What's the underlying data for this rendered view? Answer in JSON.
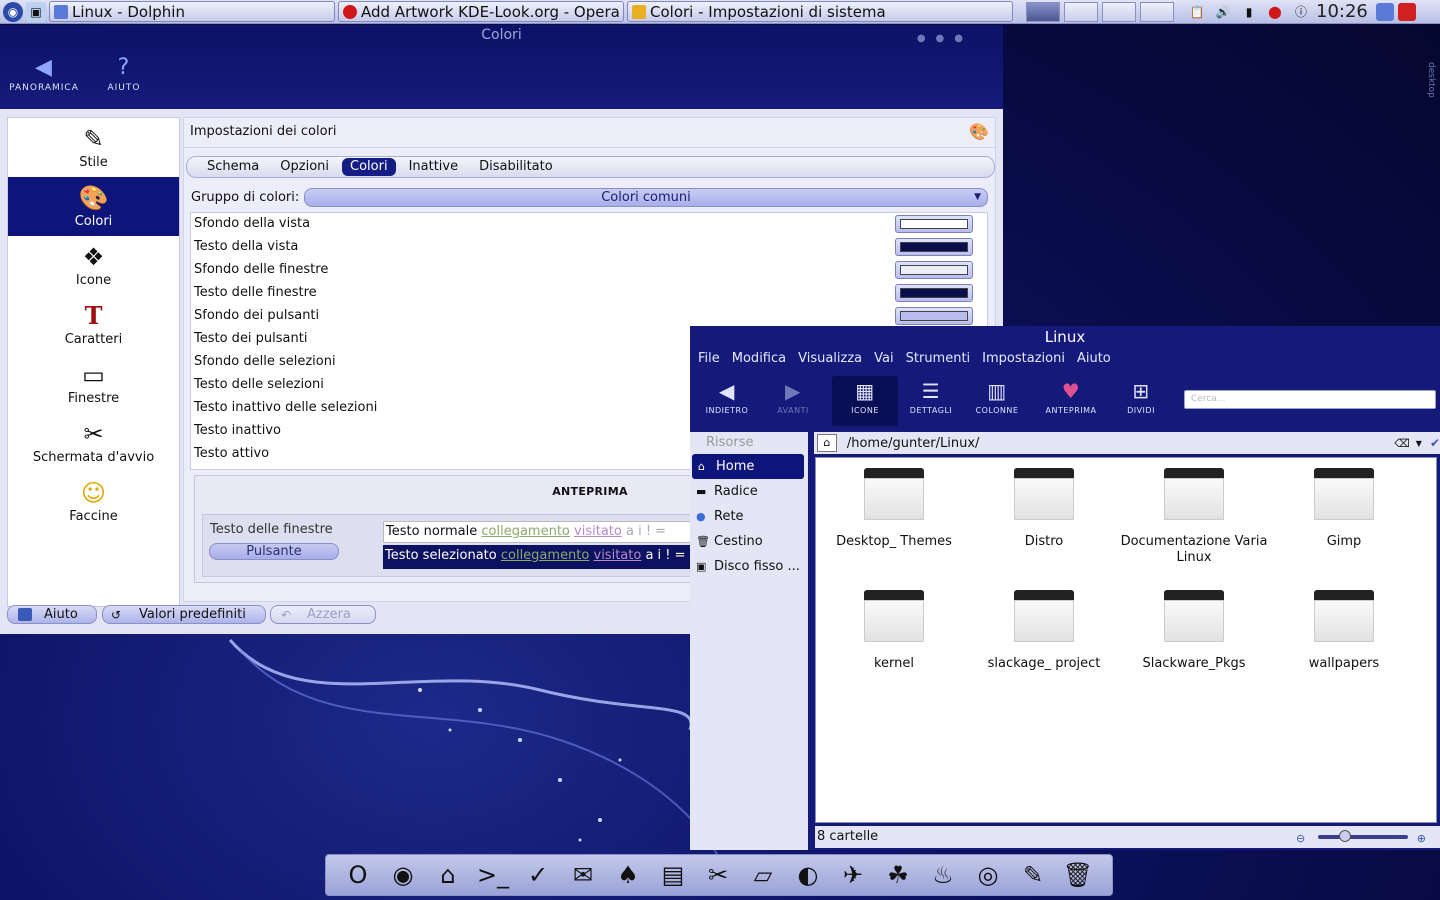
{
  "taskbar": {
    "tasks": [
      {
        "label": "Linux - Dolphin",
        "width": 286
      },
      {
        "label": "Add Artwork KDE-Look.org - Opera",
        "width": 286
      },
      {
        "label": "Colori - Impostazioni di sistema",
        "width": 386
      }
    ],
    "clock": "10:26"
  },
  "sysset": {
    "title": "Colori",
    "toolbar": {
      "overview": "PANORAMICA",
      "help": "AIUTO"
    },
    "sidebar": [
      {
        "label": "Stile",
        "icon": "✎"
      },
      {
        "label": "Colori",
        "icon": "🎨"
      },
      {
        "label": "Icone",
        "icon": "❖"
      },
      {
        "label": "Caratteri",
        "icon": "T"
      },
      {
        "label": "Finestre",
        "icon": "▭"
      },
      {
        "label": "Schermata d'avvio",
        "icon": "✂"
      },
      {
        "label": "Faccine",
        "icon": "☺"
      }
    ],
    "panel_title": "Impostazioni dei colori",
    "tabs": [
      "Schema",
      "Opzioni",
      "Colori",
      "Inattive",
      "Disabilitato"
    ],
    "group_label": "Gruppo di colori:",
    "group_value": "Colori comuni",
    "colors": [
      {
        "label": "Sfondo della vista",
        "color": "#ffffff"
      },
      {
        "label": "Testo della vista",
        "color": "#0a0e4a"
      },
      {
        "label": "Sfondo delle finestre",
        "color": "#eceef8"
      },
      {
        "label": "Testo delle finestre",
        "color": "#0a0e4a"
      },
      {
        "label": "Sfondo dei pulsanti",
        "color": "#b9bdee"
      },
      {
        "label": "Testo dei pulsanti",
        "color": ""
      },
      {
        "label": "Sfondo delle selezioni",
        "color": ""
      },
      {
        "label": "Testo delle selezioni",
        "color": ""
      },
      {
        "label": "Testo inattivo delle selezioni",
        "color": ""
      },
      {
        "label": "Testo inattivo",
        "color": ""
      },
      {
        "label": "Testo attivo",
        "color": ""
      }
    ],
    "preview": {
      "title": "ANTEPRIMA",
      "window_text": "Testo delle finestre",
      "button": "Pulsante",
      "normal_text": "Testo normale",
      "selected_text": "Testo selezionato",
      "link": "collegamento",
      "visited": "visitato",
      "tail": "a i  !  ="
    },
    "buttons": {
      "help": "Aiuto",
      "defaults": "Valori predefiniti",
      "reset": "Azzera"
    }
  },
  "dolphin": {
    "title": "Linux",
    "menu": [
      "File",
      "Modifica",
      "Visualizza",
      "Vai",
      "Strumenti",
      "Impostazioni",
      "Aiuto"
    ],
    "tools": [
      {
        "label": "INDIETRO",
        "icon": "◀"
      },
      {
        "label": "AVANTI",
        "icon": "▶"
      },
      {
        "label": "ICONE",
        "icon": "▦"
      },
      {
        "label": "DETTAGLI",
        "icon": "☰"
      },
      {
        "label": "COLONNE",
        "icon": "▥"
      },
      {
        "label": "ANTEPRIMA",
        "icon": "♥"
      },
      {
        "label": "DIVIDI",
        "icon": "⊞"
      }
    ],
    "search_placeholder": "Cerca...",
    "places_header": "Risorse",
    "places": [
      {
        "label": "Home",
        "icon": "⌂"
      },
      {
        "label": "Radice",
        "icon": "▬"
      },
      {
        "label": "Rete",
        "icon": "●"
      },
      {
        "label": "Cestino",
        "icon": "🗑"
      },
      {
        "label": "Disco fisso ...",
        "icon": "▣"
      }
    ],
    "path": "/home/gunter/Linux/",
    "folders": [
      {
        "name": "Desktop_ Themes"
      },
      {
        "name": "Distro"
      },
      {
        "name": "Documentazione Varia Linux"
      },
      {
        "name": "Gimp"
      },
      {
        "name": "kernel"
      },
      {
        "name": "slackage_ project"
      },
      {
        "name": "Slackware_Pkgs"
      },
      {
        "name": "wallpapers"
      }
    ],
    "status": "8 cartelle",
    "zoom_level": 0.25
  },
  "dock": [
    "O",
    "◉",
    "⌂",
    ">_",
    "✓",
    "✉",
    "♠",
    "▤",
    "✂",
    "▱",
    "◐",
    "✈",
    "☘",
    "♨",
    "◎",
    "✎",
    "🗑"
  ],
  "desktop_label": "desktop"
}
